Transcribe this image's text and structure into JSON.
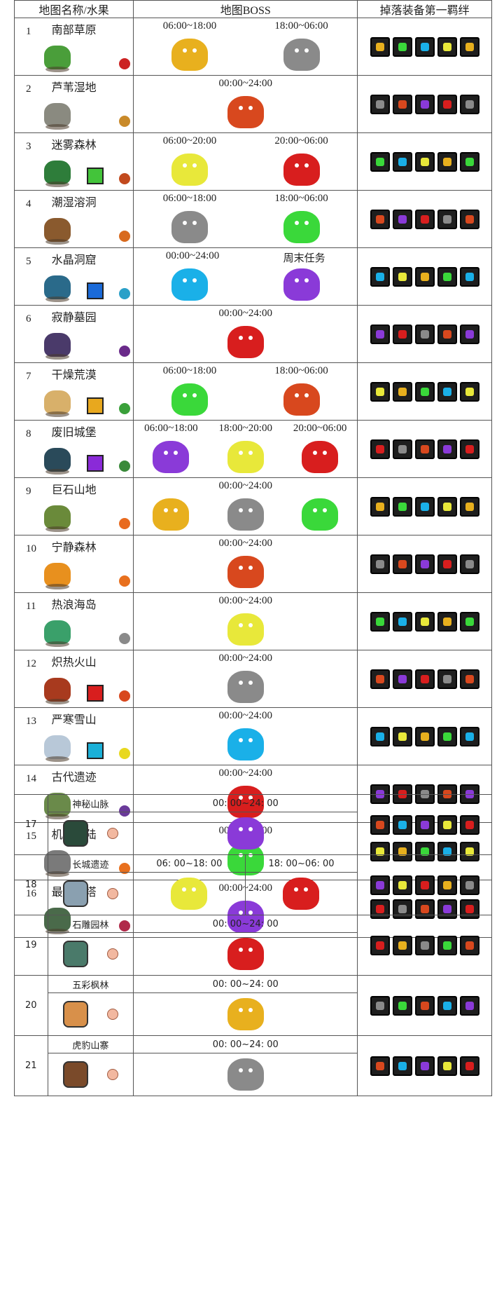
{
  "headers": {
    "map": "地图名称/水果",
    "boss": "地图BOSS",
    "drops": "掉落装备第一羁绊"
  },
  "rows": [
    {
      "num": "1",
      "name": "南部草原",
      "times": [
        "06:00~18:00",
        "18:00~06:00"
      ],
      "island": "#4a9e3a",
      "gem": null,
      "fruit": "#c22"
    },
    {
      "num": "2",
      "name": "芦苇湿地",
      "times": [
        "00:00~24:00"
      ],
      "island": "#8a8a80",
      "gem": null,
      "fruit": "#c98a2a"
    },
    {
      "num": "3",
      "name": "迷雾森林",
      "times": [
        "06:00~20:00",
        "20:00~06:00"
      ],
      "island": "#2e7d3a",
      "gem": "#43c43a",
      "fruit": "#c24a1e"
    },
    {
      "num": "4",
      "name": "潮湿溶洞",
      "times": [
        "06:00~18:00",
        "18:00~06:00"
      ],
      "island": "#8a5a2e",
      "gem": null,
      "fruit": "#d86a1e"
    },
    {
      "num": "5",
      "name": "水晶洞窟",
      "times": [
        "00:00~24:00",
        "周末任务"
      ],
      "island": "#2a6a8a",
      "gem": "#1a6ad8",
      "fruit": "#2aa0c8"
    },
    {
      "num": "6",
      "name": "寂静墓园",
      "times": [
        "00:00~24:00"
      ],
      "island": "#4a3a6a",
      "gem": null,
      "fruit": "#6a2a8a"
    },
    {
      "num": "7",
      "name": "干燥荒漠",
      "times": [
        "06:00~18:00",
        "18:00~06:00"
      ],
      "island": "#d8b06a",
      "gem": "#e8a81e",
      "fruit": "#3aa03a"
    },
    {
      "num": "8",
      "name": "废旧城堡",
      "times": [
        "06:00~18:00",
        "18:00~20:00",
        "20:00~06:00"
      ],
      "island": "#2a4a5a",
      "gem": "#8a2ad8",
      "fruit": "#3a8a3a"
    },
    {
      "num": "9",
      "name": "巨石山地",
      "times": [
        "00:00~24:00"
      ],
      "island": "#6a8a3a",
      "gem": null,
      "fruit": "#e86a1e"
    },
    {
      "num": "10",
      "name": "宁静森林",
      "times": [
        "00:00~24:00"
      ],
      "island": "#e8901e",
      "gem": null,
      "fruit": "#e8701e"
    },
    {
      "num": "11",
      "name": "热浪海岛",
      "times": [
        "00:00~24:00"
      ],
      "island": "#3aa06a",
      "gem": null,
      "fruit": "#8a8a8a"
    },
    {
      "num": "12",
      "name": "炽热火山",
      "times": [
        "00:00~24:00"
      ],
      "island": "#a83a1e",
      "gem": "#d81e1e",
      "fruit": "#d8481e"
    },
    {
      "num": "13",
      "name": "严寒雪山",
      "times": [
        "00:00~24:00"
      ],
      "island": "#b8c8d8",
      "gem": "#1ab0d8",
      "fruit": "#e8d81e"
    },
    {
      "num": "14",
      "name": "古代遗迹",
      "times": [
        "00:00~24:00"
      ],
      "island": "#6a8a4a",
      "gem": null,
      "fruit": "#6a3a9a"
    },
    {
      "num": "15",
      "name": "机械大陆",
      "times": [
        "00:00~24:00"
      ],
      "island": "#7a7a7a",
      "gem": null,
      "fruit": "#e8701e"
    },
    {
      "num": "16",
      "name": "最终之塔",
      "times": [
        "00:00~24:00"
      ],
      "island": "#4a6a4a",
      "gem": null,
      "fruit": "#b02a4a"
    }
  ],
  "rows2": [
    {
      "num": "17",
      "name": "神秘山脉",
      "times": [
        "00: 00~24: 00"
      ],
      "house": "#2a4a3a"
    },
    {
      "num": "18",
      "name": "长城遗迹",
      "times": [
        "06: 00~18: 00",
        "18: 00~06: 00"
      ],
      "house": "#8aa0b0"
    },
    {
      "num": "19",
      "name": "石雕园林",
      "times": [
        "00: 00~24: 00"
      ],
      "house": "#4a7a6a"
    },
    {
      "num": "20",
      "name": "五彩枫林",
      "times": [
        "00: 00~24: 00"
      ],
      "house": "#d8904a"
    },
    {
      "num": "21",
      "name": "虎豹山寨",
      "times": [
        "00: 00~24: 00"
      ],
      "house": "#7a4a2a"
    }
  ],
  "colors": {
    "drop_palette": [
      "#e8b01e",
      "#8a8a8a",
      "#3ad83a",
      "#d8481e",
      "#1ab0e8",
      "#8a3ad8",
      "#e8e83a",
      "#d81e1e"
    ]
  }
}
